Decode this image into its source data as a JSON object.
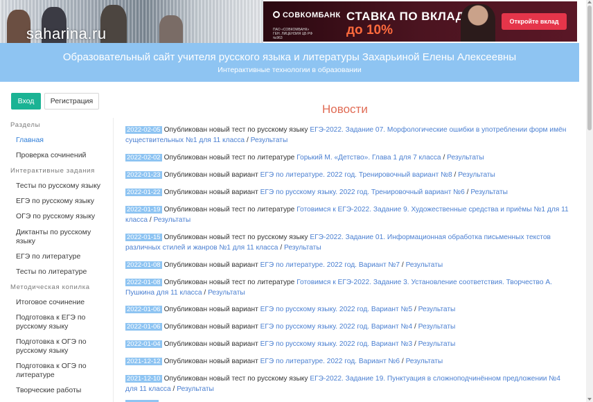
{
  "header": {
    "logo_text": "saharina.ru",
    "site_title": "Образовательный сайт учителя русского языка и литературы Захарьиной Елены Алексеевны",
    "site_subtitle": "Интерактивные технологии в образовании"
  },
  "ad": {
    "brand": "СОВКОМБАНК",
    "legal": "ПАО «СОВКОМБАНК» ГЕН. ЛИЦЕНЗИЯ ЦБ РФ №963",
    "headline": "СТАВКА ПО ВКЛАДУ",
    "rate": "до 10%",
    "button": "Откройте вклад"
  },
  "auth": {
    "login": "Вход",
    "register": "Регистрация"
  },
  "sidebar": {
    "sections": [
      {
        "title": "Разделы",
        "items": [
          "Главная",
          "Проверка сочинений"
        ]
      },
      {
        "title": "Интерактивные задания",
        "items": [
          "Тесты по русскому языку",
          "ЕГЭ по русскому языку",
          "ОГЭ по русскому языку",
          "Диктанты по русскому языку",
          "ЕГЭ по литературе",
          "Тесты по литературе"
        ]
      },
      {
        "title": "Методическая копилка",
        "items": [
          "Итоговое сочинение",
          "Подготовка к ЕГЭ по русскому языку",
          "Подготовка к ОГЭ по русскому языку",
          "Подготовка к ОГЭ по литературе",
          "Творческие работы"
        ]
      }
    ],
    "active_item": "Главная"
  },
  "news": {
    "heading": "Новости",
    "results_label": "Результаты",
    "items": [
      {
        "date": "2022-02-05",
        "text": "Опубликован новый тест по русскому языку",
        "link": "ЕГЭ-2022. Задание 07. Морфологические ошибки в употреблении форм имён существительных №1 для 11 класса"
      },
      {
        "date": "2022-02-02",
        "text": "Опубликован новый тест по литературе",
        "link": "Горький М. «Детство». Глава 1 для 7 класса"
      },
      {
        "date": "2022-01-23",
        "text": "Опубликован новый вариант",
        "link": "ЕГЭ по литературе. 2022 год. Тренировочный вариант №8"
      },
      {
        "date": "2022-01-22",
        "text": "Опубликован новый вариант",
        "link": "ЕГЭ по русскому языку. 2022 год. Тренировочный вариант №6"
      },
      {
        "date": "2022-01-19",
        "text": "Опубликован новый тест по литературе",
        "link": "Готовимся к ЕГЭ-2022. Задание 9. Художественные средства и приёмы №1 для 11 класса"
      },
      {
        "date": "2022-01-15",
        "text": "Опубликован новый тест по русскому языку",
        "link": "ЕГЭ-2022. Задание 01. Информационная обработка письменных текстов различных стилей и жанров №1 для 11 класса"
      },
      {
        "date": "2022-01-08",
        "text": "Опубликован новый вариант",
        "link": "ЕГЭ по литературе. 2022 год. Вариант №7"
      },
      {
        "date": "2022-01-08",
        "text": "Опубликован новый тест по литературе",
        "link": "Готовимся к ЕГЭ-2022. Задание 3. Установление соответствия. Творчество А. Пушкина для 11 класса"
      },
      {
        "date": "2022-01-06",
        "text": "Опубликован новый вариант",
        "link": "ЕГЭ по русскому языку. 2022 год. Вариант №5"
      },
      {
        "date": "2022-01-06",
        "text": "Опубликован новый вариант",
        "link": "ЕГЭ по русскому языку. 2022 год. Вариант №4"
      },
      {
        "date": "2022-01-04",
        "text": "Опубликован новый вариант",
        "link": "ЕГЭ по русскому языку. 2022 год. Вариант №3"
      },
      {
        "date": "2021-12-12",
        "text": "Опубликован новый вариант",
        "link": "ЕГЭ по литературе. 2022 год. Вариант №6"
      },
      {
        "date": "2021-12-10",
        "text": "Опубликован новый тест по русскому языку",
        "link": "ЕГЭ-2022. Задание 19. Пунктуация в сложноподчинённом предложении №4 для 11 класса"
      }
    ]
  }
}
